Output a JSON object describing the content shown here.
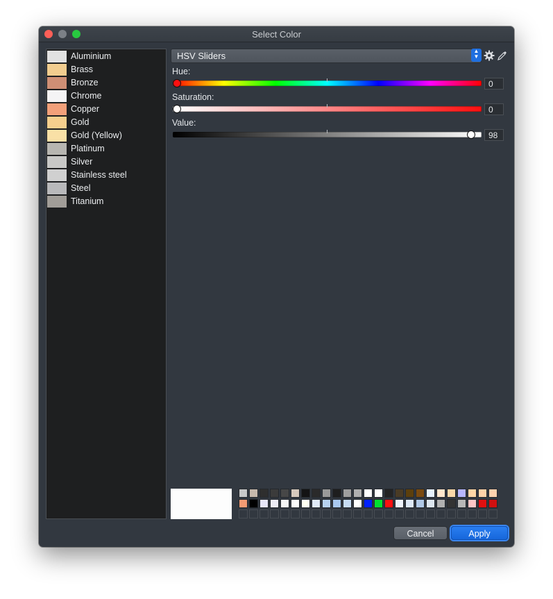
{
  "window": {
    "title": "Select Color",
    "controls": {
      "close_color": "#fe5f57",
      "minimize_color": "#7b8086",
      "maximize_color": "#28c840"
    }
  },
  "materials": [
    {
      "label": "Aluminium",
      "color": "#e2e2e2"
    },
    {
      "label": "Brass",
      "color": "#f2cd8f"
    },
    {
      "label": "Bronze",
      "color": "#cf8f75"
    },
    {
      "label": "Chrome",
      "color": "#f5f4f5"
    },
    {
      "label": "Copper",
      "color": "#f3a07a"
    },
    {
      "label": "Gold",
      "color": "#f6cf8d"
    },
    {
      "label": "Gold (Yellow)",
      "color": "#f9e0a6"
    },
    {
      "label": "Platinum",
      "color": "#b7b6b1"
    },
    {
      "label": "Silver",
      "color": "#c8c8c6"
    },
    {
      "label": "Stainless steel",
      "color": "#d0d0d0"
    },
    {
      "label": "Steel",
      "color": "#b9b9bb"
    },
    {
      "label": "Titanium",
      "color": "#a19d98"
    }
  ],
  "mode": {
    "label": "HSV Sliders",
    "options_icon": "gear-icon",
    "picker_icon": "eyedropper-icon"
  },
  "sliders": [
    {
      "label": "Hue:",
      "value": "0",
      "level": 0.0
    },
    {
      "label": "Saturation:",
      "value": "0",
      "level": 0.0
    },
    {
      "label": "Value:",
      "value": "98",
      "level": 0.98
    }
  ],
  "preview_color": "#fdfdfd",
  "palette": {
    "row1": [
      "#c8c8c8",
      "#c5b8ac",
      "#2e2e2e",
      "#3b3b3b",
      "#474747",
      "#d6c9bc",
      "#141414",
      "#2a2a2a",
      "#9a9a9a",
      "#1e1e1e",
      "#9e9e9e",
      "#b0b0b0",
      "#ffffff",
      "#ffffff",
      "#232323",
      "#4a3b25",
      "#5c3f0d",
      "#7a4a10",
      "#e6f0fb",
      "#ffe6cc",
      "#f8d7a8",
      "#b6b6ff",
      "#ffd6a6",
      "#ffd2a8",
      "#ffd2ae"
    ],
    "row2": [
      "#f49b73",
      "#000000",
      "#e6e6f7",
      "#ececf4",
      "#f5f5f5",
      "#fbfbfb",
      "#fffff2",
      "#dfe9f7",
      "#b6d2f0",
      "#a8c8f0",
      "#c6dcf4",
      "#ffffff",
      "#0020ff",
      "#00e030",
      "#ff1010",
      "#eef3fb",
      "#dde8f6",
      "#b0c8e6",
      "#dde6ef",
      "#b0b0b0",
      "#333333",
      "#b8b8b8",
      "#ffc6c6",
      "#e01010",
      "#d01010"
    ],
    "row3_empty": 25
  },
  "buttons": {
    "cancel": "Cancel",
    "apply": "Apply"
  }
}
